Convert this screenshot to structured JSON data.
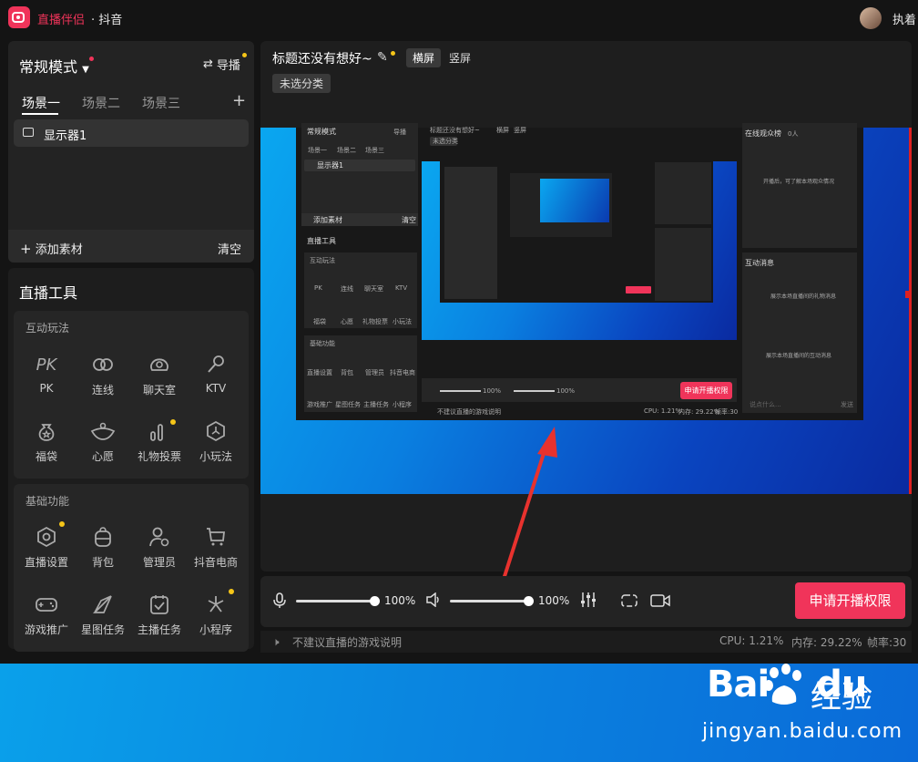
{
  "app": {
    "name": "直播伴侣",
    "platform": "· 抖音",
    "user_name": "执着"
  },
  "scene_panel": {
    "mode": "常规模式",
    "guide_label": "导播",
    "tabs": [
      "场景一",
      "场景二",
      "场景三"
    ],
    "add_tab": "+",
    "sources": [
      {
        "label": "显示器1"
      }
    ],
    "add_material": "添加素材",
    "clear": "清空"
  },
  "tools": {
    "title": "直播工具",
    "interact": {
      "title": "互动玩法",
      "items": [
        {
          "label": "PK",
          "icon": "pk-icon"
        },
        {
          "label": "连线",
          "icon": "link-icon"
        },
        {
          "label": "聊天室",
          "icon": "chatroom-icon"
        },
        {
          "label": "KTV",
          "icon": "microphone-icon"
        },
        {
          "label": "福袋",
          "icon": "lucky-bag-icon"
        },
        {
          "label": "心愿",
          "icon": "wish-icon"
        },
        {
          "label": "礼物投票",
          "icon": "gift-vote-icon"
        },
        {
          "label": "小玩法",
          "icon": "mini-game-icon"
        }
      ]
    },
    "basic": {
      "title": "基础功能",
      "items": [
        {
          "label": "直播设置",
          "icon": "live-settings-icon"
        },
        {
          "label": "背包",
          "icon": "backpack-icon"
        },
        {
          "label": "管理员",
          "icon": "admin-icon"
        },
        {
          "label": "抖音电商",
          "icon": "cart-icon"
        },
        {
          "label": "游戏推广",
          "icon": "gamepad-icon"
        },
        {
          "label": "星图任务",
          "icon": "star-map-icon"
        },
        {
          "label": "主播任务",
          "icon": "task-icon"
        },
        {
          "label": "小程序",
          "icon": "mini-program-icon"
        }
      ]
    }
  },
  "preview": {
    "title": "标题还没有想好~",
    "orientation": {
      "landscape": "横屏",
      "portrait": "竖屏"
    },
    "category": "未选分类"
  },
  "nested_capture": {
    "mode": "常规模式",
    "guide": "导播",
    "tabs": [
      "场景一",
      "场景二",
      "场景三"
    ],
    "source": "显示器1",
    "add_material": "添加素材",
    "clear": "清空",
    "tools_title": "直播工具",
    "interact_title": "互动玩法",
    "interact_items": [
      "PK",
      "连线",
      "聊天室",
      "KTV",
      "福袋",
      "心愿",
      "礼物投票",
      "小玩法"
    ],
    "basic_title": "基础功能",
    "basic_items": [
      "直播设置",
      "背包",
      "管理员",
      "抖音电商",
      "游戏推广",
      "星图任务",
      "主播任务",
      "小程序"
    ],
    "title": "标题还没有想好~",
    "landscape": "横屏",
    "portrait": "竖屏",
    "category": "未选分类",
    "audience_title": "在线观众榜",
    "audience_count": "0人",
    "audience_empty": "开播后，可了解本场观众情况",
    "interact_msg_title": "互动消息",
    "interact_msg_1": "展示本场直播间的礼物消息",
    "interact_msg_2": "展示本场直播间的互动消息",
    "chat_placeholder": "说点什么...",
    "send": "发送",
    "mic_volume": "100%",
    "speaker_volume": "100%",
    "apply_live": "申请开播权限",
    "tip": "不建议直播的游戏说明",
    "cpu": "CPU: 1.21%",
    "memory": "内存: 29.22%",
    "fps": "帧率:30"
  },
  "controls": {
    "mic_volume": "100%",
    "speaker_volume": "100%",
    "apply_live": "申请开播权限"
  },
  "status": {
    "tip": "不建议直播的游戏说明",
    "cpu": "CPU: 1.21%",
    "memory": "内存: 29.22%",
    "fps": "帧率:30"
  },
  "watermark": {
    "logo": "Bai",
    "logo_tail": "du",
    "cn": "经验",
    "url": "jingyan.baidu.com"
  },
  "colors": {
    "accent": "#f0345a",
    "badge": "#f5c518",
    "panel": "#232323",
    "background": "#141414"
  }
}
